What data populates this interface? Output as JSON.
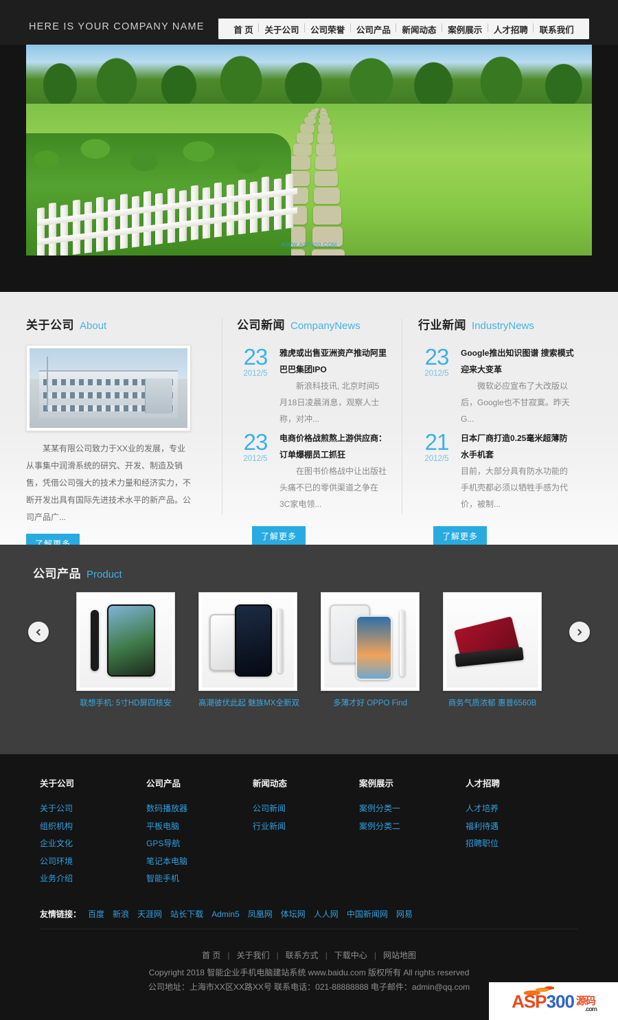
{
  "header": {
    "company_name": "HERE IS YOUR COMPANY NAME",
    "nav": [
      "首 页",
      "关于公司",
      "公司荣誉",
      "公司产品",
      "新闻动态",
      "案例展示",
      "人才招聘",
      "联系我们"
    ]
  },
  "banner": {
    "caption": "WWW.ASP300.COM"
  },
  "about": {
    "title_cn": "关于公司",
    "title_en": "About",
    "text": "某某有限公司致力于XX业的发展，专业从事集中润滑系统的研究、开发、制造及销售，凭借公司强大的技术力量和经济实力，不断开发出具有国际先进技术水平的新产品。公司产品广...",
    "more_label": "了解更多"
  },
  "company_news": {
    "title_cn": "公司新闻",
    "title_en": "CompanyNews",
    "more_label": "了解更多",
    "items": [
      {
        "day": "23",
        "ym": "2012/5",
        "title": "雅虎或出售亚洲资产推动阿里巴巴集团IPO",
        "desc": "新浪科技讯, 北京时间5月18日凌晨消息，观察人士称，对冲..."
      },
      {
        "day": "23",
        "ym": "2012/5",
        "title": "电商价格战煎熬上游供应商：订单爆棚员工抓狂",
        "desc": "在图书价格战中让出版社头痛不已的零供渠道之争在3C家电领..."
      }
    ]
  },
  "industry_news": {
    "title_cn": "行业新闻",
    "title_en": "IndustryNews",
    "more_label": "了解更多",
    "items": [
      {
        "day": "23",
        "ym": "2012/5",
        "title": "Google推出知识图谱 搜索模式迎来大变革",
        "desc": "微软必应宣布了大改版以后，Google也不甘寂寞。昨天G..."
      },
      {
        "day": "21",
        "ym": "2012/5",
        "title": "日本厂商打造0.25毫米超薄防水手机套",
        "desc": "目前，大部分具有防水功能的手机壳都必须以牺牲手感为代价，被制..."
      }
    ]
  },
  "products": {
    "title_cn": "公司产品",
    "title_en": "Product",
    "prev_label": "‹",
    "next_label": "›",
    "items": [
      {
        "caption": "联想手机: 5寸HD屏四核安"
      },
      {
        "caption": "高潮彼伏此起 魅族MX全新双"
      },
      {
        "caption": "多薄才好 OPPO Find"
      },
      {
        "caption": "商务气质浓郁 惠普6560B"
      }
    ]
  },
  "footer": {
    "columns": [
      {
        "heading": "关于公司",
        "links": [
          "关于公司",
          "组织机构",
          "企业文化",
          "公司环境",
          "业务介绍"
        ]
      },
      {
        "heading": "公司产品",
        "links": [
          "数码播放器",
          "平板电脑",
          "GPS导航",
          "笔记本电脑",
          "智能手机"
        ]
      },
      {
        "heading": "新闻动态",
        "links": [
          "公司新闻",
          "行业新闻"
        ]
      },
      {
        "heading": "案例展示",
        "links": [
          "案例分类一",
          "案例分类二"
        ]
      },
      {
        "heading": "人才招聘",
        "links": [
          "人才培养",
          "福利待遇",
          "招聘职位"
        ]
      }
    ],
    "friendly": {
      "label": "友情链接：",
      "links": [
        "百度",
        "新浪",
        "天涯网",
        "站长下载",
        "Admin5",
        "凤凰网",
        "体坛网",
        "人人网",
        "中国新闻网",
        "网易"
      ]
    },
    "bottom_links": [
      "首 页",
      "关于我们",
      "联系方式",
      "下载中心",
      "网站地图"
    ],
    "copyright": "Copyright 2018 智能企业手机电脑建站系统 www.baidu.com 版权所有 All rights reserved",
    "contact": "公司地址：上海市XX区XX路XX号 联系电话：021-88888888 电子邮件：admin@qq.com"
  },
  "watermark": {
    "asp": "ASP",
    "num": "300",
    "cn": "源码",
    "com": ".com"
  },
  "colors": {
    "accent": "#29abe2",
    "link": "#2f9fe0",
    "dark": "#141414",
    "product_bg": "#3e3e3e"
  }
}
